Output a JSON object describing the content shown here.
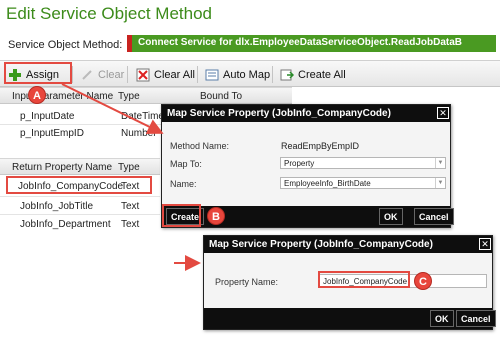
{
  "header": {
    "title": "Edit Service Object Method",
    "service_object_label": "Service Object Method:",
    "service_object_value": "Connect Service for dlx.EmployeeDataServiceObject.ReadJobDataB"
  },
  "toolbar": {
    "assign": "Assign",
    "clear": "Clear",
    "clear_all": "Clear All",
    "auto_map": "Auto Map",
    "create_all": "Create All"
  },
  "input_table": {
    "col_name": "Input Parameter Name",
    "col_type": "Type",
    "col_bound": "Bound To",
    "rows": [
      {
        "name": "p_InputDate",
        "type": "DateTime"
      },
      {
        "name": "p_InputEmpID",
        "type": "Number"
      }
    ]
  },
  "return_table": {
    "col_name": "Return Property Name",
    "col_type": "Type",
    "rows": [
      {
        "name": "JobInfo_CompanyCode",
        "type": "Text"
      },
      {
        "name": "JobInfo_JobTitle",
        "type": "Text"
      },
      {
        "name": "JobInfo_Department",
        "type": "Text"
      }
    ]
  },
  "dialog_map": {
    "title": "Map Service Property (JobInfo_CompanyCode)",
    "method_name_label": "Method Name:",
    "method_name_value": "ReadEmpByEmpID",
    "map_to_label": "Map To:",
    "map_to_value": "Property",
    "name_label": "Name:",
    "name_value": "EmployeeInfo_BirthDate",
    "create": "Create",
    "ok": "OK",
    "cancel": "Cancel"
  },
  "dialog_prop": {
    "title": "Map Service Property (JobInfo_CompanyCode)",
    "property_name_label": "Property Name:",
    "property_name_value": "JobInfo_CompanyCode",
    "ok": "OK",
    "cancel": "Cancel"
  },
  "callouts": {
    "a": "A",
    "b": "B",
    "c": "C"
  },
  "colors": {
    "title_green": "#3c8b1a",
    "field_green": "#4a9a22",
    "callout_red": "#e8463c",
    "dialog_black": "#0e0e0e"
  }
}
